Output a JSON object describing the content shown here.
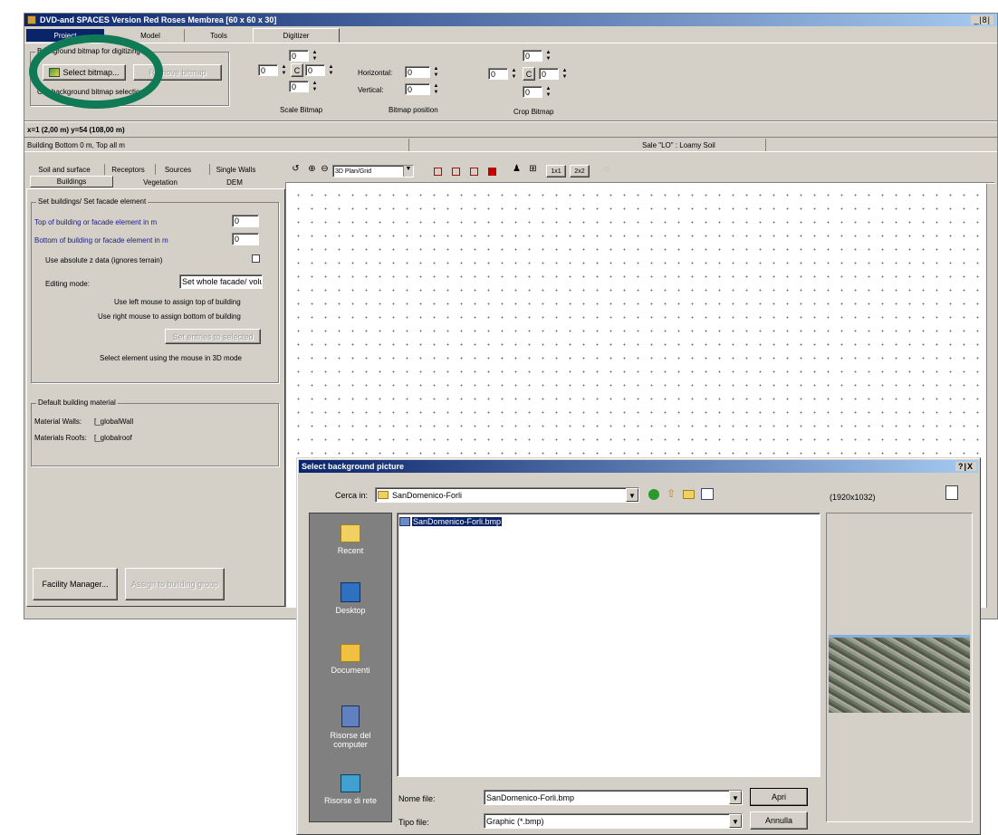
{
  "main_window": {
    "title": "DVD-and SPACES Version Red Roses Membrea [60 x 60 x 30]",
    "title_controls": "_|8|",
    "menu_tabs": [
      "Project",
      "Model",
      "Tools",
      "Digitizer"
    ],
    "bg_group_label": "Background bitmap for digitizing",
    "select_bitmap_label": "Select bitmap...",
    "remove_bitmap_label": "Remove bitmap",
    "clip_label": "Clip background bitmap selection",
    "scale_label": "Scale Bitmap",
    "position_label": "Bitmap position",
    "horizontal_label": "Horizontal:",
    "vertical_label": "Vertical:",
    "crop_label": "Crop Bitmap",
    "spin_value": "0",
    "center_btn": "C",
    "coords_text": "x=1 (2,00 m) y=54 (108,00 m)",
    "status_left": "Building Bottom 0 m, Top all m",
    "status_mid": "Sale \"LO\" : Loamy Soil"
  },
  "left_panel": {
    "tabs_row1": [
      "Soil and surface",
      "Receptors",
      "Sources",
      "Single Walls"
    ],
    "tabs_row2": [
      "Buildings",
      "Vegetation",
      "DEM"
    ],
    "set_group_label": "Set buildings/ Set facade element",
    "top_label": "Top of building or facade element in m",
    "bottom_label": "Bottom of building or facade element in m",
    "top_value": "0",
    "bottom_value": "0",
    "absolute_label": "Use absolute z data (ignores terrain)",
    "editing_label": "Editing mode:",
    "editing_value": "Set whole facade/ volume",
    "hint_left": "Use left mouse to assign top of building",
    "hint_right": "Use right mouse to assign bottom of building",
    "set_selected_label": "Set entries to selected",
    "select_hint": "Select element using the mouse in 3D mode",
    "default_group_label": "Default building material",
    "walls_label": "Material Walls:",
    "walls_value": "[_globalWall",
    "roofs_label": "Materials Roofs:",
    "roofs_value": "[_globalroof",
    "facility_label": "Facility Manager...",
    "assign_label": "Assign to building group"
  },
  "toolbar": {
    "view_select": "3D Plan/Grid",
    "btn_1x1": "1x1",
    "btn_2x2": "2x2"
  },
  "dialog": {
    "title": "Select background picture",
    "title_controls": "?|X",
    "look_in_label": "Cerca in:",
    "look_in_value": "SanDomenico-Forli",
    "file_item": "SanDomenico-Forli.bmp",
    "resolution": "(1920x1032)",
    "places": [
      "Recent",
      "Desktop",
      "Documenti",
      "Risorse del computer",
      "Risorse di rete"
    ],
    "filename_label": "Nome file:",
    "filename_value": "SanDomenico-Forli.bmp",
    "filetype_label": "Tipo file:",
    "filetype_value": "Graphic (*.bmp)",
    "open_label": "Apri",
    "cancel_label": "Annulla"
  }
}
